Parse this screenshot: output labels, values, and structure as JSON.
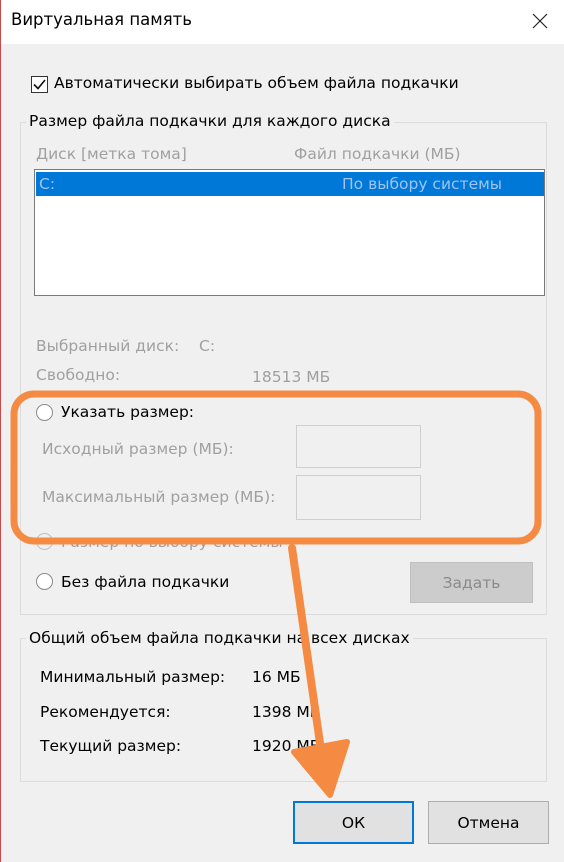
{
  "window": {
    "title": "Виртуальная память"
  },
  "auto_manage": {
    "label": "Автоматически выбирать объем файла подкачки",
    "checked": true
  },
  "per_drive": {
    "legend": "Размер файла подкачки для каждого диска",
    "columns": {
      "drive": "Диск [метка тома]",
      "paging_file": "Файл подкачки (МБ)"
    },
    "rows": [
      {
        "drive": "C:",
        "paging_file": "По выбору системы"
      }
    ],
    "selected_drive_label": "Выбранный диск:",
    "selected_drive_value": "C:",
    "free_label": "Свободно:",
    "free_value": "18513 МБ",
    "custom_size": {
      "label": "Указать размер:"
    },
    "initial_size": {
      "label": "Исходный размер (МБ):",
      "value": ""
    },
    "max_size": {
      "label": "Максимальный размер (МБ):",
      "value": ""
    },
    "system_managed": {
      "label": "Размер по выбору системы"
    },
    "no_paging": {
      "label": "Без файла подкачки"
    },
    "set_button": "Задать"
  },
  "totals": {
    "legend": "Общий объем файла подкачки на всех дисках",
    "min_label": "Минимальный размер:",
    "min_value": "16 МБ",
    "recommended_label": "Рекомендуется:",
    "recommended_value": "1398 МБ",
    "current_label": "Текущий размер:",
    "current_value": "1920 МБ"
  },
  "buttons": {
    "ok": "ОК",
    "cancel": "Отмена"
  },
  "annotation": {
    "color": "#f58a42"
  }
}
